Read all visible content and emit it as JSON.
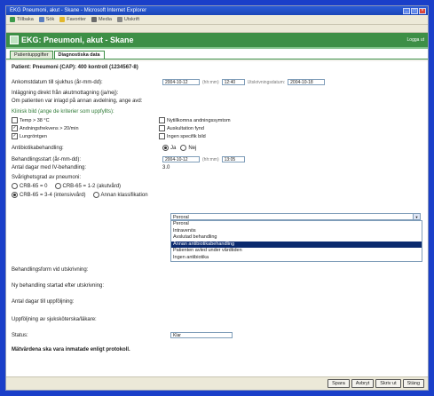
{
  "window": {
    "title": "EKG Pneumoni, akut - Skane - Microsoft Internet Explorer"
  },
  "toolbar": {
    "items": [
      "Tillbaka",
      "Sök",
      "Favoriter",
      "Media",
      "Utskrift"
    ]
  },
  "header": {
    "title": "EKG: Pneumoni, akut - Skane",
    "right": "Logga ut"
  },
  "tabs": [
    "Patientuppgifter",
    "Diagnostiska data"
  ],
  "patient": "Patient: Pneumoni (CAP): 400 kontroll (1234567-8)",
  "form": {
    "dates_label": "Ankomstdatum till sjukhus (år-mm-dd):",
    "arrival_date": "2004-10-12",
    "arrival_time": "12:40",
    "time_hint": "(hh:mm)",
    "discharge_label": "Utskrivningsdatum:",
    "discharge_date": "2004-10-18",
    "question1": "Inläggning direkt från akutmottagning (ja/nej):",
    "question1b": "Om patienten var inlagd på annan avdelning, ange avd:",
    "green_label": "Klinisk bild (ange de kriterier som uppfyllts):",
    "checkboxes": [
      {
        "label": "Temp > 38 °C",
        "checked": false
      },
      {
        "label": "Nytillkomna andningssymtom",
        "checked": false
      },
      {
        "label": "Andningsfrekvens > 20/min",
        "checked": true
      },
      {
        "label": "Auskultation fynd",
        "checked": false
      },
      {
        "label": "Lungröntgen",
        "checked": true
      },
      {
        "label": "Ingen specifik bild",
        "checked": false
      }
    ],
    "radio_label": "Antibiotikabehandling:",
    "radio_yes": "Ja",
    "radio_no": "Nej",
    "treatment_label": "Behandlingsstart (år-mm-dd):",
    "treatment_date": "2004-10-12",
    "treatment_time": "13:05",
    "duration_label": "Antal dagar med IV-behandling:",
    "duration_value": "3.0",
    "severity_label": "Svårighetsgrad av pneumoni:",
    "severity_options": [
      "CRB-65 = 0",
      "CRB-65 = 1-2 (akutvård)",
      "CRB-65 = 3-4 (intensivvård)",
      "Annan klassifikation"
    ],
    "select_label": "Behandlingsform vid utskrivning:",
    "select_value": "Peroral",
    "dropdown_options": [
      "Peroral",
      "Intravenös",
      "Avslutad behandling",
      "Annan antibiotikabehandling",
      "Patienten avled under vårdtiden",
      "Ingen antibiotika"
    ],
    "dropdown_selected": 3,
    "field_labels": [
      "Ny behandling startad efter utskrivning:",
      "Antal dagar till uppföljning:",
      "Uppföljning av sjuksköterska/läkare:",
      "Status:"
    ],
    "status_value": "Klar",
    "note": "Mätvärdena ska vara inmatade enligt protokoll."
  },
  "footer": {
    "buttons": [
      "Spara",
      "Avbryt",
      "Skriv ut",
      "Stäng"
    ]
  }
}
